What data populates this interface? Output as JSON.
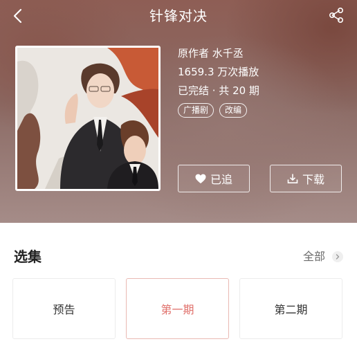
{
  "colors": {
    "accent": "#e0706b",
    "accent_border": "#e9b9b3",
    "hero_bg": "#8e5e55"
  },
  "nav": {
    "title": "针锋对决",
    "back_icon": "chevron-left-icon",
    "share_icon": "share-icon"
  },
  "detail": {
    "author": "原作者 水千丞",
    "plays": "1659.3 万次播放",
    "status": "已完结 · 共 20 期",
    "tags": [
      "广播剧",
      "改编"
    ]
  },
  "actions": {
    "follow_label": "已追",
    "follow_icon": "heart-icon",
    "download_label": "下载",
    "download_icon": "download-icon"
  },
  "episodes_section": {
    "title": "选集",
    "see_all": "全部",
    "items": [
      {
        "label": "预告",
        "selected": false
      },
      {
        "label": "第一期",
        "selected": true
      },
      {
        "label": "第二期",
        "selected": false
      }
    ]
  }
}
